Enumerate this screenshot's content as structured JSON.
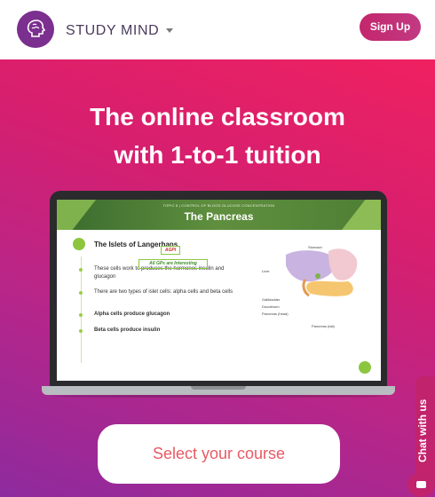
{
  "header": {
    "brand": "STUDY MIND",
    "signup_label": "Sign Up"
  },
  "hero": {
    "title_line1": "The online classroom",
    "title_line2": "with 1-to-1 tuition",
    "cta_label": "Select your course"
  },
  "slide": {
    "subtitle": "TOPIC 8 | CONTROL OF BLOOD GLUCOSE CONCENTRATION",
    "title": "The Pancreas",
    "heading": "The Islets of Langerhans",
    "bullets": [
      "These cells work to produces the hormones insulin and glucagon",
      "There are two types of islet cells: alpha cells and beta cells",
      "Alpha cells produce glucagon",
      "Beta cells produce insulin"
    ],
    "badge1": "AGPI",
    "badge2": "All GPs are Interesting",
    "organs": {
      "stomach": "Stomach",
      "liver": "Liver",
      "gallbladder": "Gallbladder",
      "duodenum": "Duodenum",
      "pancreas_head": "Pancreas (head)",
      "pancreas_tail": "Pancreas (tail)"
    }
  },
  "chat": {
    "label": "Chat with us"
  },
  "colors": {
    "brand_purple": "#7b2f8e",
    "accent_pink": "#c4266c",
    "cta_text": "#e85a65"
  }
}
